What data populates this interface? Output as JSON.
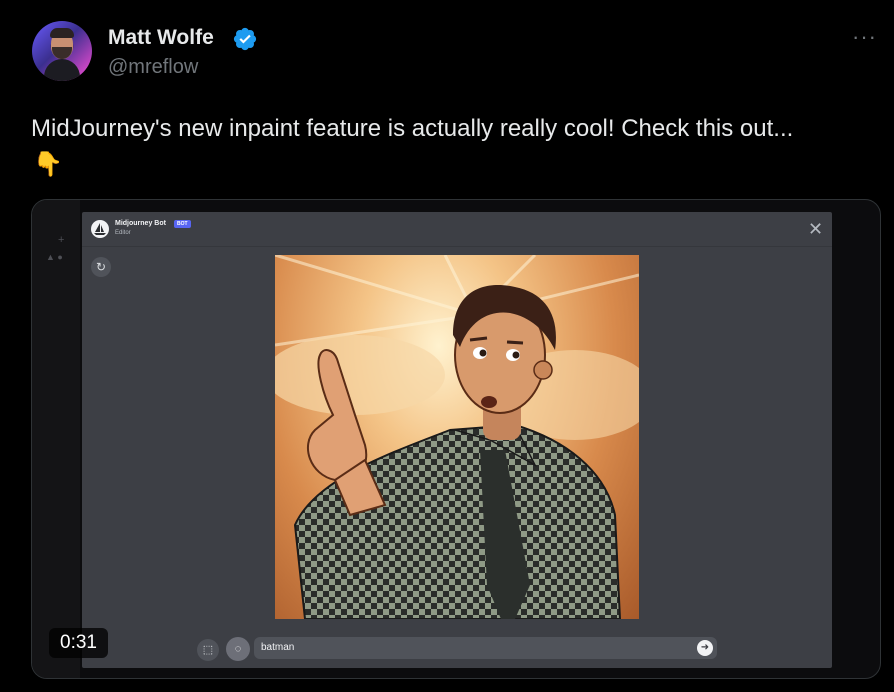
{
  "author": {
    "name": "Matt Wolfe",
    "handle": "@mreflow"
  },
  "tweet": {
    "text": "MidJourney's new inpaint feature is actually really cool! Check this out...",
    "emoji": "👇",
    "more_label": "···"
  },
  "video": {
    "duration": "0:31",
    "editor": {
      "bot_name": "Midjourney Bot",
      "bot_badge": "BOT",
      "subtitle": "Editor",
      "close_label": "✕",
      "undo_label": "↻",
      "prompt_value": "batman",
      "send_label": "➜"
    }
  },
  "colors": {
    "background": "#000000",
    "text": "#e7e9ea",
    "muted": "#71767b",
    "verified": "#1d9bf0",
    "editor_bg": "#3d3f45",
    "badge": "#5865f2"
  },
  "icons": {
    "verified": "verified-badge-icon",
    "more": "more-options-icon",
    "undo": "undo-icon",
    "rect_select": "rectangle-select-icon",
    "lasso": "lasso-icon",
    "send": "send-arrow-icon"
  }
}
